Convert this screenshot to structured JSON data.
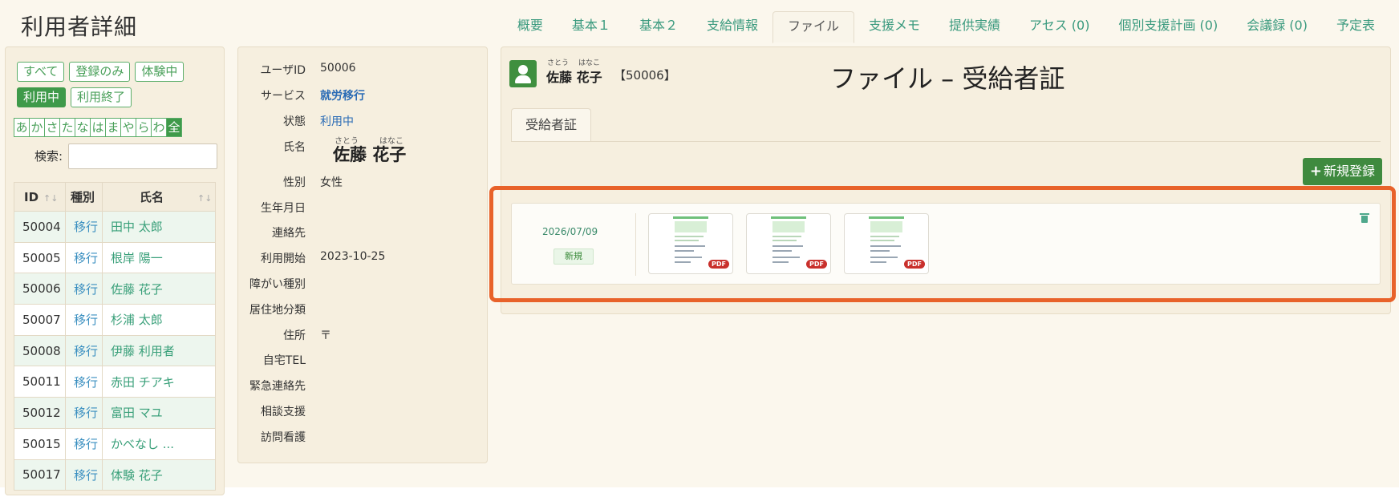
{
  "page": {
    "title": "利用者詳細"
  },
  "tabs": [
    {
      "label": "概要"
    },
    {
      "label": "基本１"
    },
    {
      "label": "基本２"
    },
    {
      "label": "支給情報"
    },
    {
      "label": "ファイル",
      "active": true
    },
    {
      "label": "支援メモ"
    },
    {
      "label": "提供実績"
    },
    {
      "label": "アセス (0)"
    },
    {
      "label": "個別支援計画 (0)"
    },
    {
      "label": "会議録 (0)"
    },
    {
      "label": "予定表"
    }
  ],
  "filters": {
    "status": [
      "すべて",
      "登録のみ",
      "体験中",
      "利用中",
      "利用終了"
    ],
    "active_status": "利用中",
    "kana": [
      "あ",
      "か",
      "さ",
      "た",
      "な",
      "は",
      "ま",
      "や",
      "ら",
      "わ",
      "全"
    ],
    "active_kana": "全",
    "search_label": "検索:",
    "search_value": ""
  },
  "user_table": {
    "headers": [
      "ID",
      "種別",
      "氏名"
    ],
    "rows": [
      {
        "id": "50004",
        "kind": "移行",
        "name": "田中 太郎"
      },
      {
        "id": "50005",
        "kind": "移行",
        "name": "根岸 陽一"
      },
      {
        "id": "50006",
        "kind": "移行",
        "name": "佐藤 花子"
      },
      {
        "id": "50007",
        "kind": "移行",
        "name": "杉浦 太郎"
      },
      {
        "id": "50008",
        "kind": "移行",
        "name": "伊藤 利用者"
      },
      {
        "id": "50011",
        "kind": "移行",
        "name": "赤田 チアキ"
      },
      {
        "id": "50012",
        "kind": "移行",
        "name": "富田 マユ"
      },
      {
        "id": "50015",
        "kind": "移行",
        "name": "かべなし ..."
      },
      {
        "id": "50017",
        "kind": "移行",
        "name": "体験 花子"
      }
    ]
  },
  "info": {
    "user_id_label": "ユーザID",
    "user_id": "50006",
    "service_label": "サービス",
    "service": "就労移行",
    "status_label": "状態",
    "status": "利用中",
    "name_label": "氏名",
    "name": "佐藤 花子",
    "ruby_family": "さとう",
    "ruby_given": "はなこ",
    "gender_label": "性別",
    "gender": "女性",
    "birthday_label": "生年月日",
    "birthday": "",
    "contact_label": "連絡先",
    "contact": "",
    "start_label": "利用開始",
    "start": "2023-10-25",
    "disability_label": "障がい種別",
    "disability": "",
    "residence_label": "居住地分類",
    "residence": "",
    "address_label": "住所",
    "address": "〒",
    "home_tel_label": "自宅TEL",
    "home_tel": "",
    "emergency_label": "緊急連絡先",
    "emergency": "",
    "consult_label": "相談支援",
    "consult": "",
    "nursing_label": "訪問看護",
    "nursing": ""
  },
  "main": {
    "user_name": "佐藤 花子",
    "user_id_bracket": "【50006】",
    "ruby_family": "さとう",
    "ruby_given": "はなこ",
    "title": "ファイル – 受給者証",
    "subtab": "受給者証",
    "new_button": "新規登録",
    "file": {
      "date": "2026/07/09",
      "badge": "新規",
      "files": [
        {
          "type": "PDF"
        },
        {
          "type": "PDF"
        },
        {
          "type": "PDF"
        }
      ]
    }
  },
  "colors": {
    "accent": "#3f8a3f",
    "highlight": "#e8622a",
    "link": "#3aa07a"
  }
}
